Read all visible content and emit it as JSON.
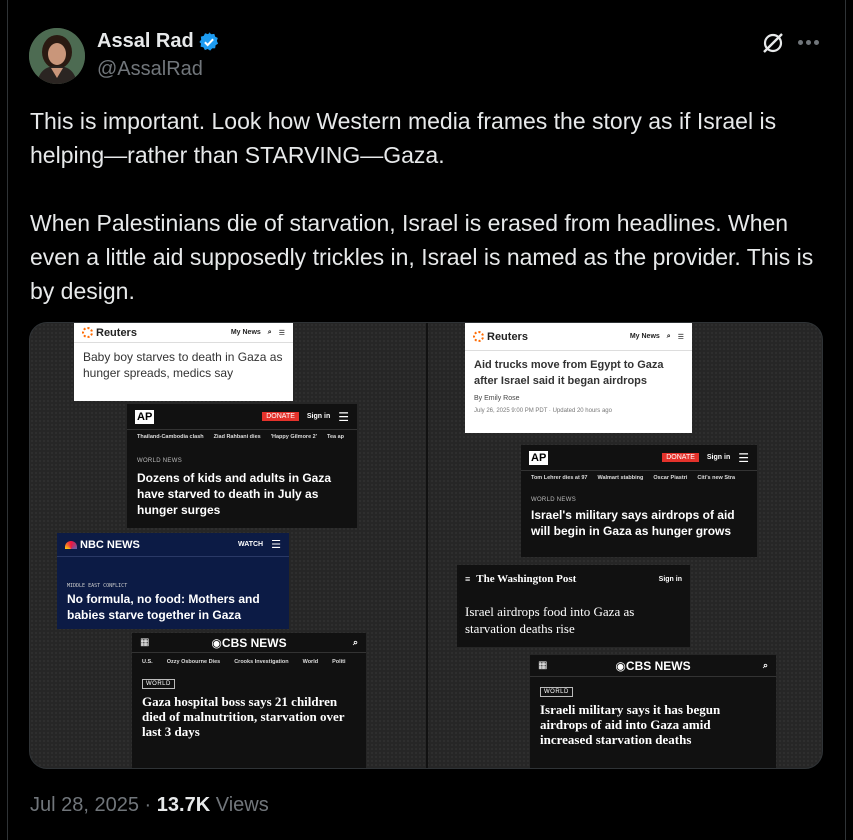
{
  "author": {
    "display_name": "Assal Rad",
    "handle": "@AssalRad",
    "verified": true,
    "avatar": "avatar-photo"
  },
  "tweet": {
    "text": "This is important. Look how Western media frames the story as if Israel is helping—rather than STARVING—Gaza.\n\nWhen Palestinians die of starvation, Israel is erased from headlines. When even a little aid supposedly trickles in, Israel is named as the provider. This is by design.",
    "date": "Jul 28, 2025",
    "separator": "·",
    "views_count": "13.7K",
    "views_label": "Views"
  },
  "icons": {
    "verified": "verified-badge-icon",
    "grok": "grok-icon",
    "more": "more-icon",
    "search": "search-icon",
    "menu": "hamburger-menu-icon",
    "grid": "grid-icon"
  },
  "colors": {
    "background": "#000000",
    "text": "#e7e9ea",
    "secondary": "#71767b",
    "verified_blue": "#1d9bf0",
    "ap_donate": "#e4322b",
    "nbc_bg": "#0c1b45"
  },
  "media": {
    "left": {
      "reuters": {
        "logo": "Reuters",
        "my_news": "My News",
        "title": "Baby boy starves to death in Gaza as hunger spreads, medics say"
      },
      "ap": {
        "logo": "AP",
        "donate": "DONATE",
        "signin": "Sign in",
        "nav": [
          "Thailand-Cambodia clash",
          "Ziad Rahbani dies",
          "'Happy Gilmore 2'",
          "Tea ap"
        ],
        "kicker": "WORLD NEWS",
        "title": "Dozens of kids and adults in Gaza have starved to death in July as hunger surges"
      },
      "nbc": {
        "logo": "NBC NEWS",
        "watch": "WATCH",
        "kicker": "MIDDLE EAST CONFLICT",
        "title": "No formula, no food: Mothers and babies starve together in Gaza"
      },
      "cbs": {
        "logo": "CBS NEWS",
        "nav": [
          "U.S.",
          "Ozzy Osbourne Dies",
          "Crooks Investigation",
          "World",
          "Politi"
        ],
        "tag": "WORLD",
        "title": "Gaza hospital boss says 21 children died of malnutrition, starvation over last 3 days"
      }
    },
    "right": {
      "reuters": {
        "logo": "Reuters",
        "my_news": "My News",
        "title": "Aid trucks move from Egypt to Gaza after Israel said it began airdrops",
        "byline": "By Emily Rose",
        "date": "July 26, 2025 9:00 PM PDT · Updated 20 hours ago"
      },
      "ap": {
        "logo": "AP",
        "donate": "DONATE",
        "signin": "Sign in",
        "nav": [
          "Tom Lehrer dies at 97",
          "Walmart stabbing",
          "Oscar Piastri",
          "Citi's new Stra"
        ],
        "kicker": "WORLD NEWS",
        "title": "Israel's military says airdrops of aid will begin in Gaza as hunger grows"
      },
      "wapo": {
        "logo": "The Washington Post",
        "signin": "Sign in",
        "title": "Israel airdrops food into Gaza as starvation deaths rise"
      },
      "cbs": {
        "logo": "CBS NEWS",
        "tag": "WORLD",
        "title": "Israeli military says it has begun airdrops of aid into Gaza amid increased starvation deaths"
      }
    }
  }
}
